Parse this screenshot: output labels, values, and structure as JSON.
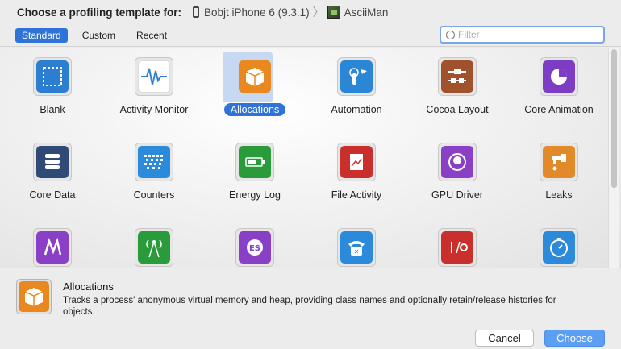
{
  "header": {
    "title": "Choose a profiling template for:",
    "device": "Bobjt iPhone 6 (9.3.1)",
    "app": "AsciiMan"
  },
  "toolbar": {
    "tabs": [
      "Standard",
      "Custom",
      "Recent"
    ],
    "active_tab": "Standard",
    "filter_placeholder": "Filter"
  },
  "templates": [
    {
      "label": "Blank",
      "icon": "blank-icon",
      "color": "#2c7fd0"
    },
    {
      "label": "Activity Monitor",
      "icon": "waveform-icon",
      "color": "#ffffff"
    },
    {
      "label": "Allocations",
      "icon": "box-icon",
      "color": "#e8881e",
      "selected": true
    },
    {
      "label": "Automation",
      "icon": "tap-icon",
      "color": "#2c86d6"
    },
    {
      "label": "Cocoa Layout",
      "icon": "layout-icon",
      "color": "#a0522d"
    },
    {
      "label": "Core Animation",
      "icon": "pie-icon",
      "color": "#7d3cc4"
    },
    {
      "label": "Core Data",
      "icon": "database-icon",
      "color": "#2f4a75"
    },
    {
      "label": "Counters",
      "icon": "counters-icon",
      "color": "#2b8ad9"
    },
    {
      "label": "Energy Log",
      "icon": "battery-icon",
      "color": "#2a9b3a"
    },
    {
      "label": "File Activity",
      "icon": "file-icon",
      "color": "#c9302c"
    },
    {
      "label": "GPU Driver",
      "icon": "gpu-icon",
      "color": "#8a3fc7"
    },
    {
      "label": "Leaks",
      "icon": "faucet-icon",
      "color": "#e2892a"
    },
    {
      "label": "",
      "icon": "metal-icon",
      "color": "#8a3fc7"
    },
    {
      "label": "",
      "icon": "network-tower-icon",
      "color": "#2a9b3a"
    },
    {
      "label": "",
      "icon": "opengl-es-icon",
      "color": "#8a3fc7"
    },
    {
      "label": "",
      "icon": "telephone-icon",
      "color": "#2b8ad9"
    },
    {
      "label": "",
      "icon": "io-icon",
      "color": "#c9302c"
    },
    {
      "label": "",
      "icon": "timer-icon",
      "color": "#2b8ad9"
    }
  ],
  "description": {
    "name": "Allocations",
    "text": "Tracks a process' anonymous virtual memory and heap, providing class names and optionally retain/release histories for objects."
  },
  "footer": {
    "cancel_label": "Cancel",
    "choose_label": "Choose"
  }
}
